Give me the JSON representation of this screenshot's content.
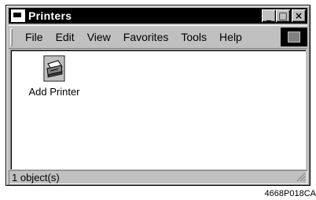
{
  "window": {
    "title": "Printers",
    "controls": {
      "minimize": "_",
      "maximize": "□",
      "close": "×"
    }
  },
  "menu": {
    "items": [
      {
        "label": "File"
      },
      {
        "label": "Edit"
      },
      {
        "label": "View"
      },
      {
        "label": "Favorites"
      },
      {
        "label": "Tools"
      },
      {
        "label": "Help"
      }
    ]
  },
  "content": {
    "items": [
      {
        "label": "Add Printer",
        "icon": "add-printer-icon"
      }
    ]
  },
  "status": {
    "text": "1 object(s)"
  },
  "caption": "4668P018CA"
}
